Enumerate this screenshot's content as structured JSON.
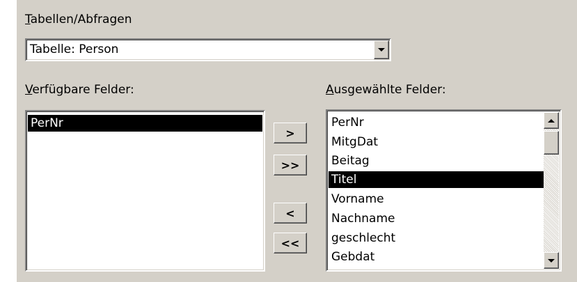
{
  "tables_queries": {
    "label_first": "T",
    "label_rest": "abellen/Abfragen",
    "selected": "Tabelle: Person"
  },
  "available_fields": {
    "label_first": "V",
    "label_rest": "erfügbare Felder:",
    "items": [
      {
        "label": "PerNr",
        "selected": true
      }
    ]
  },
  "selected_fields": {
    "label_first": "A",
    "label_rest": "usgewählte Felder:",
    "items": [
      {
        "label": "PerNr",
        "selected": false
      },
      {
        "label": "MitgDat",
        "selected": false
      },
      {
        "label": "Beitag",
        "selected": false
      },
      {
        "label": "Titel",
        "selected": true
      },
      {
        "label": "Vorname",
        "selected": false
      },
      {
        "label": "Nachname",
        "selected": false
      },
      {
        "label": "geschlecht",
        "selected": false
      },
      {
        "label": "Gebdat",
        "selected": false
      }
    ]
  },
  "buttons": {
    "add_one": ">",
    "add_all": ">>",
    "remove_one": "<",
    "remove_all": "<<"
  }
}
